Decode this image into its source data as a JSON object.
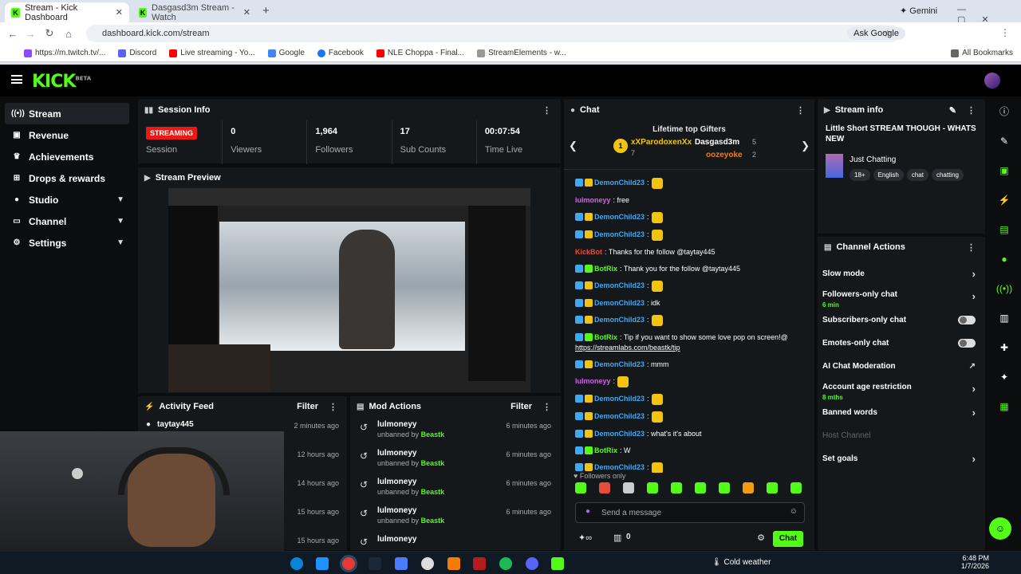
{
  "browser": {
    "tabs": [
      {
        "label": "Stream - Kick Dashboard",
        "active": true
      },
      {
        "label": "Dasgasd3m Stream - Watch",
        "active": false
      }
    ],
    "gemini": "Gemini",
    "url": "dashboard.kick.com/stream",
    "ask_google": "Ask Google",
    "all_bookmarks": "All Bookmarks",
    "bookmarks": [
      "https://m.twitch.tv/...",
      "Discord",
      "Live streaming - Yo...",
      "Google",
      "Facebook",
      "NLE Choppa - Final...",
      "StreamElements - w..."
    ]
  },
  "kick": {
    "logo": "KICK",
    "logo_sup": "BETA"
  },
  "sidebar": {
    "items": [
      {
        "label": "Stream",
        "icon": "stream-icon"
      },
      {
        "label": "Revenue",
        "icon": "revenue-icon"
      },
      {
        "label": "Achievements",
        "icon": "trophy-icon"
      },
      {
        "label": "Drops & rewards",
        "icon": "gift-icon"
      },
      {
        "label": "Studio",
        "icon": "studio-icon"
      },
      {
        "label": "Channel",
        "icon": "channel-icon"
      },
      {
        "label": "Settings",
        "icon": "gear-icon"
      }
    ]
  },
  "session": {
    "title": "Session Info",
    "status": "STREAMING",
    "status_label": "Session",
    "viewers": "0",
    "viewers_label": "Viewers",
    "followers": "1,964",
    "followers_label": "Followers",
    "subs": "17",
    "subs_label": "Sub Counts",
    "time": "00:07:54",
    "time_label": "Time Live"
  },
  "preview": {
    "title": "Stream Preview"
  },
  "activity": {
    "title": "Activity Feed",
    "filter": "Filter",
    "rows": [
      {
        "name": "taytay445",
        "time": "2 minutes ago"
      },
      {
        "name": "",
        "time": "12 hours ago"
      },
      {
        "name": "",
        "time": "14 hours ago"
      },
      {
        "name": "",
        "time": "15 hours ago"
      },
      {
        "name": "",
        "time": "15 hours ago"
      }
    ]
  },
  "mod": {
    "title": "Mod Actions",
    "filter": "Filter",
    "rows": [
      {
        "name": "lulmoneyy",
        "action": "unbanned by",
        "by": "Beastk",
        "time": "6 minutes ago"
      },
      {
        "name": "lulmoneyy",
        "action": "unbanned by",
        "by": "Beastk",
        "time": "6 minutes ago"
      },
      {
        "name": "lulmoneyy",
        "action": "unbanned by",
        "by": "Beastk",
        "time": "6 minutes ago"
      },
      {
        "name": "lulmoneyy",
        "action": "unbanned by",
        "by": "Beastk",
        "time": "6 minutes ago"
      },
      {
        "name": "lulmoneyy",
        "action": "",
        "by": "",
        "time": ""
      }
    ]
  },
  "chat": {
    "title": "Chat",
    "gifters_title": "Lifetime top Gifters",
    "gifters": [
      {
        "name": "xXParodoxenXx",
        "count": "7",
        "rank": "1"
      },
      {
        "name": "Dasgasd3m",
        "count": "5"
      },
      {
        "name": "oozeyoke",
        "count": "2"
      }
    ],
    "messages": [
      {
        "user": "DemonChild23",
        "color": "#3fa9f5",
        "text": ":"
      },
      {
        "user": "lulmoneyy",
        "color": "#d163e6",
        "text": ": free"
      },
      {
        "user": "DemonChild23",
        "color": "#3fa9f5",
        "text": ":"
      },
      {
        "user": "DemonChild23",
        "color": "#3fa9f5",
        "text": ":"
      },
      {
        "user": "KickBot",
        "color": "#e74c3c",
        "text": ": Thanks for the follow @taytay445"
      },
      {
        "user": "BotRix",
        "color": "#53fc18",
        "text": ": Thank you for the follow @taytay445"
      },
      {
        "user": "DemonChild23",
        "color": "#3fa9f5",
        "text": ":"
      },
      {
        "user": "DemonChild23",
        "color": "#3fa9f5",
        "text": ": idk"
      },
      {
        "user": "DemonChild23",
        "color": "#3fa9f5",
        "text": ":"
      },
      {
        "user": "BotRix",
        "color": "#53fc18",
        "text": ": Tip if you want to show some love pop on screen!@",
        "link": "https://streamlabs.com/beastk/tip"
      },
      {
        "user": "DemonChild23",
        "color": "#3fa9f5",
        "text": ": mmm"
      },
      {
        "user": "lulmoneyy",
        "color": "#d163e6",
        "text": ":"
      },
      {
        "user": "DemonChild23",
        "color": "#3fa9f5",
        "text": ":"
      },
      {
        "user": "DemonChild23",
        "color": "#3fa9f5",
        "text": ":"
      },
      {
        "user": "DemonChild23",
        "color": "#3fa9f5",
        "text": ": what's it's about"
      },
      {
        "user": "BotRix",
        "color": "#53fc18",
        "text": ": W"
      },
      {
        "user": "DemonChild23",
        "color": "#3fa9f5",
        "text": ":"
      }
    ],
    "followers_only": "Followers only",
    "placeholder": "Send a message",
    "send": "Chat",
    "counter": "0"
  },
  "stream_info": {
    "title": "Stream info",
    "stream_title": "Little Short STREAM THOUGH - WHATS NEW",
    "category": "Just Chatting",
    "tags": [
      "18+",
      "English",
      "chat",
      "chatting"
    ]
  },
  "channel_actions": {
    "title": "Channel Actions",
    "items": [
      {
        "label": "Slow mode",
        "control": "chevron"
      },
      {
        "label": "Followers-only chat",
        "sub": "6 min",
        "control": "chevron"
      },
      {
        "label": "Subscribers-only chat",
        "control": "toggle"
      },
      {
        "label": "Emotes-only chat",
        "control": "toggle"
      },
      {
        "label": "AI Chat Moderation",
        "control": "external"
      },
      {
        "label": "Account age restriction",
        "sub": "8 mths",
        "control": "chevron"
      },
      {
        "label": "Banned words",
        "control": "chevron"
      },
      {
        "label": "Host Channel",
        "control": "none",
        "disabled": true
      },
      {
        "label": "Set goals",
        "control": "chevron"
      }
    ]
  },
  "taskbar": {
    "weather": "Cold weather",
    "time": "6:48 PM",
    "date": "1/7/2026"
  }
}
